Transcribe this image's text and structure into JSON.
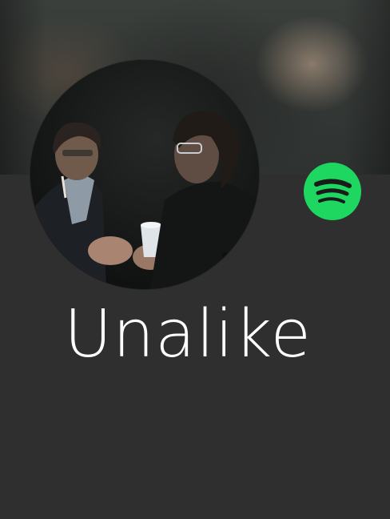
{
  "artist": {
    "name": "Unalike",
    "photo_icon": "artist-photo-image"
  },
  "spotify": {
    "icon": "spotify-logo-icon",
    "brand_color": "#1ed760"
  },
  "colors": {
    "card_background": "#2f2f2f",
    "text": "#ffffff"
  }
}
